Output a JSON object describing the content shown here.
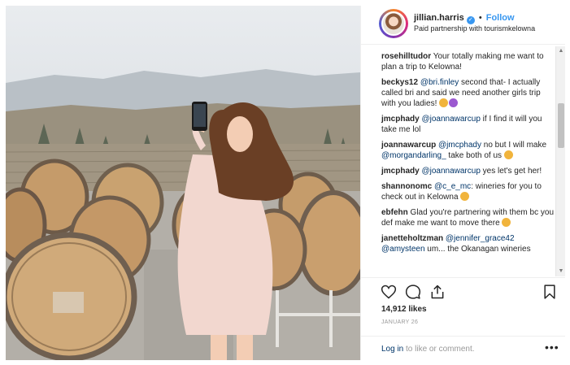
{
  "post": {
    "photo_alt": "photo"
  },
  "header": {
    "username": "jillian.harris",
    "separator": "•",
    "follow_label": "Follow",
    "subtitle": "Paid partnership with tourismkelowna"
  },
  "comments": [
    {
      "user": "rosehilltudor",
      "parts": [
        {
          "t": "text",
          "v": " Your totally making me want to plan a trip to Kelowna!"
        }
      ]
    },
    {
      "user": "beckys12",
      "parts": [
        {
          "t": "mention",
          "v": " @bri.finley"
        },
        {
          "t": "text",
          "v": " second that- I actually called bri and said we need another girls trip with you ladies! "
        },
        {
          "t": "emoji",
          "v": "#f1b43c"
        },
        {
          "t": "emoji",
          "v": "#9b59d0"
        }
      ]
    },
    {
      "user": "jmcphady",
      "parts": [
        {
          "t": "mention",
          "v": " @joannawarcup"
        },
        {
          "t": "text",
          "v": " if I find it will you take me lol"
        }
      ]
    },
    {
      "user": "joannawarcup",
      "parts": [
        {
          "t": "mention",
          "v": " @jmcphady"
        },
        {
          "t": "text",
          "v": " no but I will make "
        },
        {
          "t": "mention",
          "v": "@morgandarling_"
        },
        {
          "t": "text",
          "v": " take both of us "
        },
        {
          "t": "emoji",
          "v": "#f1b43c"
        }
      ]
    },
    {
      "user": "jmcphady",
      "parts": [
        {
          "t": "mention",
          "v": " @joannawarcup"
        },
        {
          "t": "text",
          "v": " yes let's get her!"
        }
      ]
    },
    {
      "user": "shannonomc",
      "parts": [
        {
          "t": "mention",
          "v": " @c_e_mc"
        },
        {
          "t": "text",
          "v": ": wineries for you to check out in Kelowna "
        },
        {
          "t": "emoji",
          "v": "#f1b43c"
        }
      ]
    },
    {
      "user": "ebfehn",
      "parts": [
        {
          "t": "text",
          "v": " Glad you're partnering with them bc you def make me want to move there "
        },
        {
          "t": "emoji",
          "v": "#f1b43c"
        }
      ]
    },
    {
      "user": "janetteholtzman",
      "parts": [
        {
          "t": "mention",
          "v": " @jennifer_grace42"
        },
        {
          "t": "mention",
          "v": " @amysteen"
        },
        {
          "t": "text",
          "v": " um... the Okanagan wineries"
        }
      ]
    }
  ],
  "scrollbar": {
    "up": "▲",
    "down": "▼"
  },
  "actions": {
    "like": "heart-icon",
    "comment": "comment-icon",
    "share": "share-icon",
    "save": "bookmark-icon"
  },
  "likes_text": "14,912 likes",
  "date_text": "JANUARY 26",
  "footer": {
    "login_link": "Log in",
    "login_rest": " to like or comment.",
    "more": "•••"
  }
}
